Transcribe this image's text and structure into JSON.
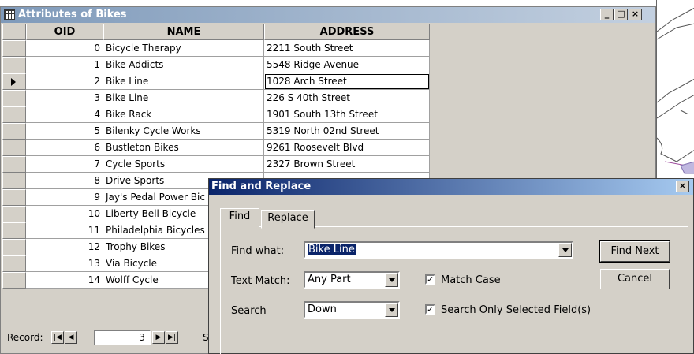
{
  "window": {
    "title": "Attributes of Bikes",
    "minimize": "_",
    "maximize": "□",
    "close": "×"
  },
  "table": {
    "columns": [
      "OID",
      "NAME",
      "ADDRESS"
    ],
    "rows": [
      {
        "oid": "0",
        "name": "Bicycle Therapy",
        "address": "2211 South Street"
      },
      {
        "oid": "1",
        "name": "Bike Addicts",
        "address": "5548 Ridge Avenue"
      },
      {
        "oid": "2",
        "name": "Bike Line",
        "address": "1028 Arch Street"
      },
      {
        "oid": "3",
        "name": "Bike Line",
        "address": "226 S 40th Street"
      },
      {
        "oid": "4",
        "name": "Bike Rack",
        "address": "1901 South 13th Street"
      },
      {
        "oid": "5",
        "name": "Bilenky Cycle Works",
        "address": "5319 North 02nd Street"
      },
      {
        "oid": "6",
        "name": "Bustleton Bikes",
        "address": "9261 Roosevelt Blvd"
      },
      {
        "oid": "7",
        "name": "Cycle Sports",
        "address": "2327 Brown Street"
      },
      {
        "oid": "8",
        "name": "Drive Sports",
        "address": ""
      },
      {
        "oid": "9",
        "name": "Jay's Pedal Power Bic",
        "address": ""
      },
      {
        "oid": "10",
        "name": "Liberty Bell Bicycle",
        "address": ""
      },
      {
        "oid": "11",
        "name": "Philadelphia Bicycles",
        "address": ""
      },
      {
        "oid": "12",
        "name": "Trophy Bikes",
        "address": ""
      },
      {
        "oid": "13",
        "name": "Via Bicycle",
        "address": ""
      },
      {
        "oid": "14",
        "name": "Wolff Cycle",
        "address": ""
      }
    ],
    "current_row_index": 2
  },
  "record_nav": {
    "label": "Record:",
    "current": "3",
    "trailing": "S"
  },
  "dialog": {
    "title": "Find and Replace",
    "close": "×",
    "tabs": [
      "Find",
      "Replace"
    ],
    "active_tab": "Find",
    "find_what_label": "Find what:",
    "find_what_value": "Bike Line",
    "text_match_label": "Text Match:",
    "text_match_value": "Any Part",
    "search_label": "Search",
    "search_value": "Down",
    "match_case_label": "Match Case",
    "match_case_checked": true,
    "selected_fields_label": "Search Only Selected Field(s)",
    "selected_fields_checked": true,
    "find_next_label": "Find Next",
    "cancel_label": "Cancel"
  },
  "colors": {
    "dialog_title": "#0a246a",
    "selection": "#0a246a",
    "face": "#d4d0c8"
  }
}
